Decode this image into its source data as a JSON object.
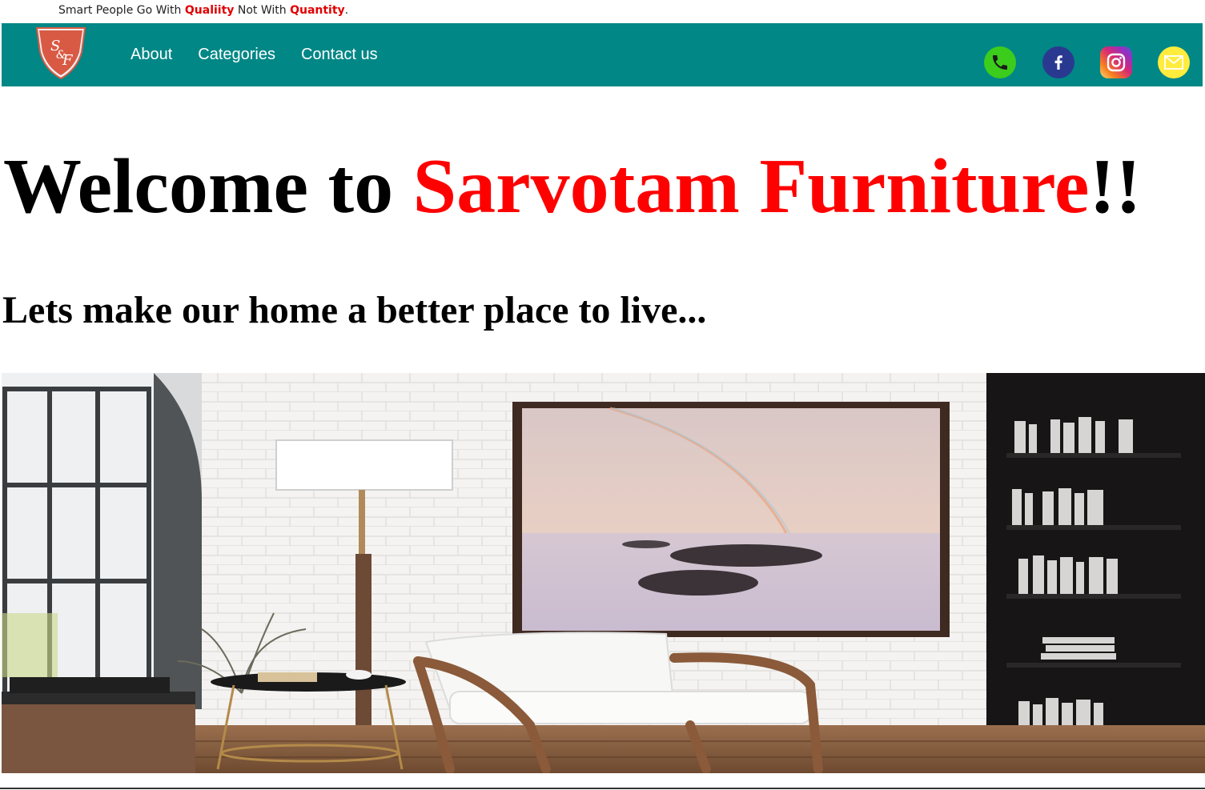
{
  "header": {
    "slogan_prefix": "Smart People Go With ",
    "slogan_quality": "Qualiity",
    "slogan_middle": " Not With ",
    "slogan_quantity": "Quantity",
    "slogan_suffix": "."
  },
  "nav": {
    "logo_icon": "sf-shield-logo-icon",
    "links": [
      {
        "label": "About"
      },
      {
        "label": "Categories"
      },
      {
        "label": "Contact us"
      }
    ],
    "social": [
      {
        "icon": "phone-icon",
        "color": "#3ccc1c"
      },
      {
        "icon": "facebook-icon",
        "color": "#2a3990"
      },
      {
        "icon": "instagram-icon",
        "color": "#d6249f"
      },
      {
        "icon": "mail-icon",
        "color": "#ffec3d"
      }
    ],
    "bg_color": "#008786"
  },
  "hero": {
    "welcome_prefix": "Welcome to ",
    "brand": "Sarvotam Furniture",
    "welcome_suffix": "!!",
    "tagline": "Lets make our home a better place to live...",
    "brand_color": "#ff0000"
  }
}
